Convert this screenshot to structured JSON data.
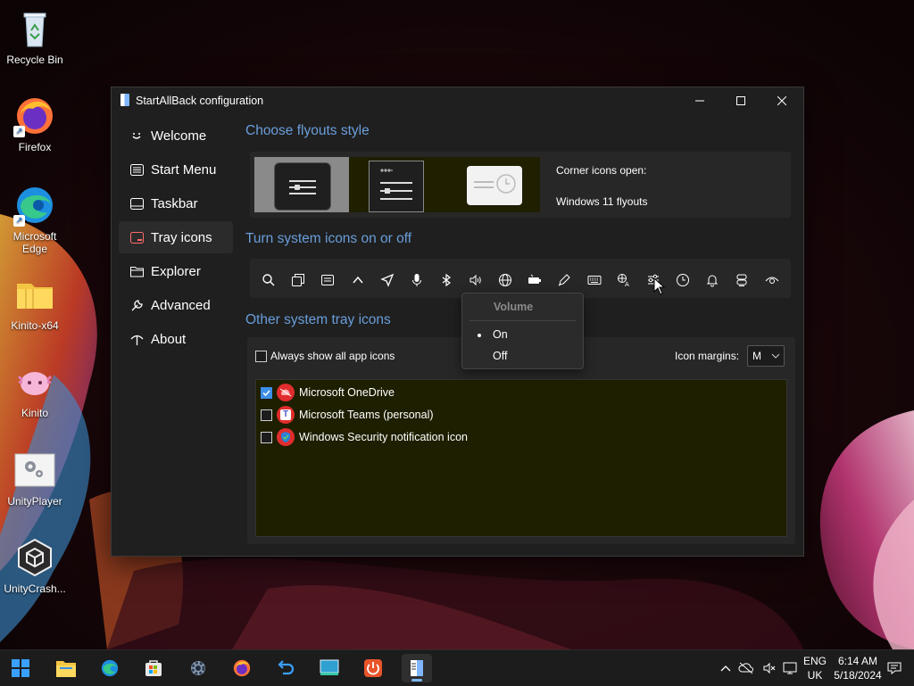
{
  "desktop": {
    "icons": [
      {
        "label": "Recycle Bin",
        "icon": "recycle-bin-icon"
      },
      {
        "label": "Firefox",
        "icon": "firefox-icon"
      },
      {
        "label": "Microsoft Edge",
        "icon": "edge-icon"
      },
      {
        "label": "Kinito-x64",
        "icon": "folder-icon"
      },
      {
        "label": "Kinito",
        "icon": "axolotl-icon"
      },
      {
        "label": "UnityPlayer",
        "icon": "settings-file-icon"
      },
      {
        "label": "UnityCrash...",
        "icon": "unity-icon"
      }
    ]
  },
  "window": {
    "title": "StartAllBack configuration",
    "nav": [
      {
        "label": "Welcome",
        "icon": "smile-icon"
      },
      {
        "label": "Start Menu",
        "icon": "start-menu-icon"
      },
      {
        "label": "Taskbar",
        "icon": "taskbar-icon"
      },
      {
        "label": "Tray icons",
        "icon": "tray-icon",
        "active": true
      },
      {
        "label": "Explorer",
        "icon": "folder-icon"
      },
      {
        "label": "Advanced",
        "icon": "wrench-icon"
      },
      {
        "label": "About",
        "icon": "about-icon"
      }
    ],
    "flyouts": {
      "title": "Choose flyouts style",
      "corner_label": "Corner icons open:",
      "corner_value": "Windows 11 flyouts"
    },
    "system_icons": {
      "title": "Turn system icons on or off",
      "icons": [
        "search-icon",
        "task-view-icon",
        "widgets-icon",
        "chevron-up-icon",
        "location-icon",
        "microphone-icon",
        "bluetooth-icon",
        "volume-icon",
        "network-icon",
        "battery-icon",
        "pen-icon",
        "touch-keyboard-icon",
        "language-icon",
        "sliders-icon",
        "clock-icon",
        "bell-icon",
        "copilot-icon",
        "eye-icon"
      ]
    },
    "volume_popup": {
      "header": "Volume",
      "options": [
        {
          "label": "On",
          "selected": true
        },
        {
          "label": "Off",
          "selected": false
        }
      ]
    },
    "other_tray": {
      "title": "Other system tray icons",
      "always_show_label": "Always show all app icons",
      "margins_label": "Icon margins:",
      "margins_value": "M",
      "items": [
        {
          "label": "Microsoft OneDrive",
          "checked": true,
          "icon": "onedrive-icon"
        },
        {
          "label": "Microsoft Teams (personal)",
          "checked": false,
          "icon": "teams-icon"
        },
        {
          "label": "Windows Security notification icon",
          "checked": false,
          "icon": "windows-security-icon"
        }
      ]
    }
  },
  "taskbar": {
    "apps": [
      "start-icon",
      "file-explorer-icon",
      "edge-icon",
      "store-icon",
      "settings-icon",
      "firefox-icon",
      "undo-app-icon",
      "monitor-app-icon",
      "power-app-icon",
      "startallback-icon"
    ],
    "lang_line1": "ENG",
    "lang_line2": "UK",
    "time": "6:14 AM",
    "date": "5/18/2024"
  },
  "colors": {
    "accent": "#6a9edb",
    "checkbox": "#3d8ee6",
    "list_bg": "#1e1e00"
  }
}
